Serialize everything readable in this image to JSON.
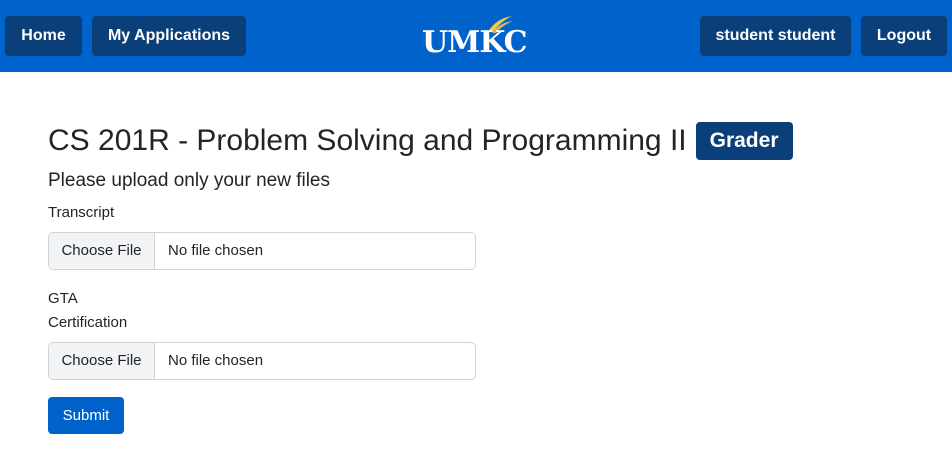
{
  "nav": {
    "home_label": "Home",
    "apps_label": "My Applications",
    "user_label": "student student",
    "logout_label": "Logout",
    "logo_text": "UMKC"
  },
  "page": {
    "title": "CS 201R - Problem Solving and Programming II",
    "badge": "Grader",
    "subtitle": "Please upload only your new files"
  },
  "form": {
    "fields": [
      {
        "label_lines": [
          "Transcript"
        ],
        "button_label": "Choose File",
        "status": "No file chosen"
      },
      {
        "label_lines": [
          "GTA",
          "Certification"
        ],
        "button_label": "Choose File",
        "status": "No file chosen"
      }
    ],
    "submit_label": "Submit"
  },
  "colors": {
    "navbar": "#0063cc",
    "nav_button": "#0b3f7a",
    "badge": "#0b3f7a",
    "primary": "#0063cc",
    "logo_accent": "#f2c94c"
  }
}
